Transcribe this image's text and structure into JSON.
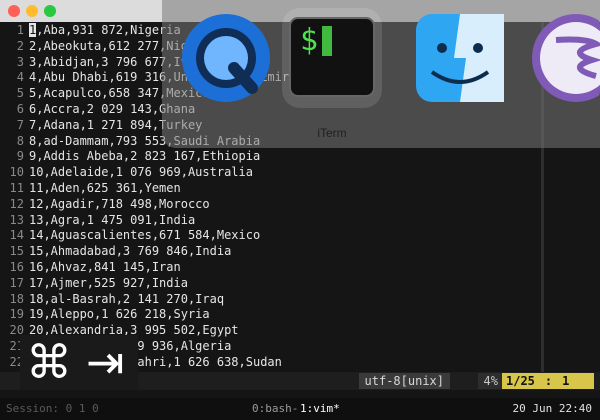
{
  "window": {
    "title": "",
    "traffic_lights": [
      "close",
      "minimize",
      "zoom"
    ]
  },
  "editor": {
    "lines": [
      {
        "num": "1",
        "text": "1,Aba,931 872,Nigeria"
      },
      {
        "num": "2",
        "text": "2,Abeokuta,612 277,Nigeria"
      },
      {
        "num": "3",
        "text": "3,Abidjan,3 796 677,Ivory Coast"
      },
      {
        "num": "4",
        "text": "4,Abu Dhabi,619 316,United Arab Emirates"
      },
      {
        "num": "5",
        "text": "5,Acapulco,658 347,Mexico"
      },
      {
        "num": "6",
        "text": "6,Accra,2 029 143,Ghana"
      },
      {
        "num": "7",
        "text": "7,Adana,1 271 894,Turkey"
      },
      {
        "num": "8",
        "text": "8,ad-Dammam,793 553,Saudi Arabia"
      },
      {
        "num": "9",
        "text": "9,Addis Abeba,2 823 167,Ethiopia"
      },
      {
        "num": "10",
        "text": "10,Adelaide,1 076 969,Australia"
      },
      {
        "num": "11",
        "text": "11,Aden,625 361,Yemen"
      },
      {
        "num": "12",
        "text": "12,Agadir,718 498,Morocco"
      },
      {
        "num": "13",
        "text": "13,Agra,1 475 091,India"
      },
      {
        "num": "14",
        "text": "14,Aguascalientes,671 584,Mexico"
      },
      {
        "num": "15",
        "text": "15,Ahmadabad,3 769 846,India"
      },
      {
        "num": "16",
        "text": "16,Ahvaz,841 145,Iran"
      },
      {
        "num": "17",
        "text": "17,Ajmer,525 927,India"
      },
      {
        "num": "18",
        "text": "18,al-Basrah,2 141 270,Iraq"
      },
      {
        "num": "19",
        "text": "19,Aleppo,1 626 218,Syria"
      },
      {
        "num": "20",
        "text": "20,Alexandria,3 995 502,Egypt"
      },
      {
        "num": "21",
        "text": "21,Algiers,2 029 936,Algeria"
      },
      {
        "num": "22",
        "text": "22,al-Khartum Bahri,1 626 638,Sudan"
      }
    ],
    "tilde": "~"
  },
  "statusbar": {
    "encoding": "utf-8[unix]",
    "percent": "4%",
    "line_pos": "1/25",
    "col_pos": "1"
  },
  "tmux": {
    "session": "Session: 0 1 0",
    "window0": "0:bash-",
    "window1": "1:vim*",
    "clock": "20 Jun 22:40"
  },
  "app_switcher": {
    "apps": [
      {
        "name": "QuickTime Player",
        "icon": "quicktime-icon"
      },
      {
        "name": "iTerm",
        "icon": "terminal-icon",
        "selected": true
      },
      {
        "name": "Finder",
        "icon": "finder-icon"
      },
      {
        "name": "Emacs",
        "icon": "emacs-icon"
      }
    ],
    "selected_label": "iTerm"
  },
  "shortcut_overlay": {
    "keys": [
      "⌘",
      "⇥"
    ]
  },
  "colors": {
    "status_position": "#d7c64a",
    "terminal_bg": "#151515",
    "terminal_prompt": "#4ee34e"
  }
}
